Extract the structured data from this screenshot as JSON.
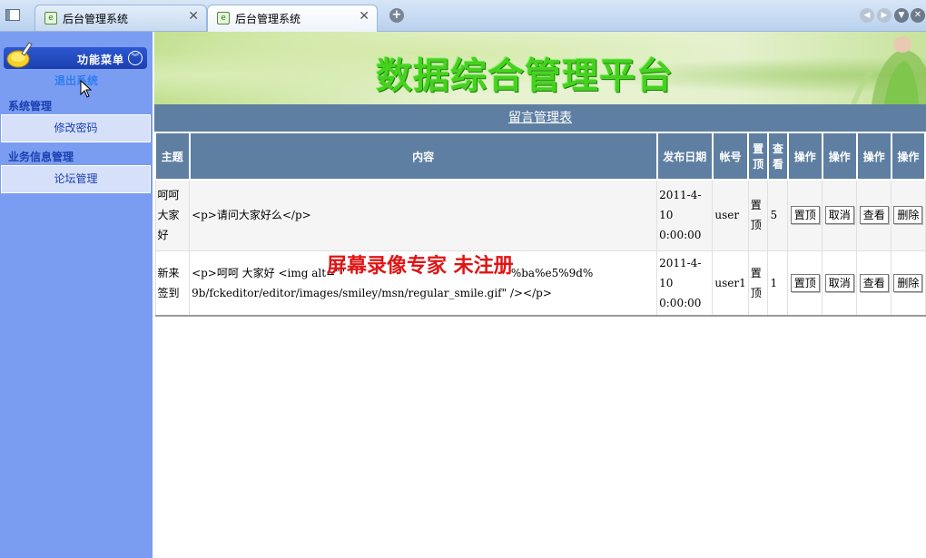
{
  "browser": {
    "tabs": [
      {
        "title": "后台管理系统",
        "active": false
      },
      {
        "title": "后台管理系统",
        "active": true
      }
    ],
    "close_glyph": "✕",
    "newtab_glyph": "+"
  },
  "sidebar": {
    "menu_title": "功能菜单",
    "logout": "退出系统",
    "groups": [
      {
        "title": "系统管理",
        "items": [
          {
            "label": "修改密码"
          }
        ]
      },
      {
        "title": "业务信息管理",
        "items": [
          {
            "label": "论坛管理"
          }
        ]
      }
    ]
  },
  "banner": {
    "title": "数据综合管理平台"
  },
  "table": {
    "caption": "留言管理表",
    "headers": [
      "主题",
      "内容",
      "发布日期",
      "帐号",
      "置顶",
      "查看",
      "操作",
      "操作",
      "操作",
      "操作"
    ],
    "rows": [
      {
        "subject": "呵呵大家好",
        "content": "<p>请问大家好么</p>",
        "date": "2011-4-10 0:00:00",
        "account": "user",
        "top": "置顶",
        "views": "5",
        "actions": [
          "置顶",
          "取消",
          "查看",
          "删除"
        ]
      },
      {
        "subject": "新来签到",
        "content": "<p>呵呵  大家好  <img alt=\"\" src=\"...%e5%9d%e7%...%ba%e5%9d%9b/fckeditor/editor/images/smiley/msn/regular_smile.gif\" /></p>",
        "content_line1": "<p>呵呵  大家好  <img alt=\"\"",
        "content_line1_tail": "%ba%e5%9d%",
        "content_line2": "9b/fckeditor/editor/images/smiley/msn/regular_smile.gif\" /></p>",
        "date": "2011-4-10 0:00:00",
        "account": "user1",
        "top": "置顶",
        "views": "1",
        "actions": [
          "置顶",
          "取消",
          "查看",
          "删除"
        ]
      }
    ]
  },
  "watermark": "屏幕录像专家  未注册",
  "colors": {
    "sidebar_bg": "#7b9df1",
    "header_bg": "#5e7fa2",
    "banner_title": "#45d21f",
    "watermark": "#e01515"
  }
}
